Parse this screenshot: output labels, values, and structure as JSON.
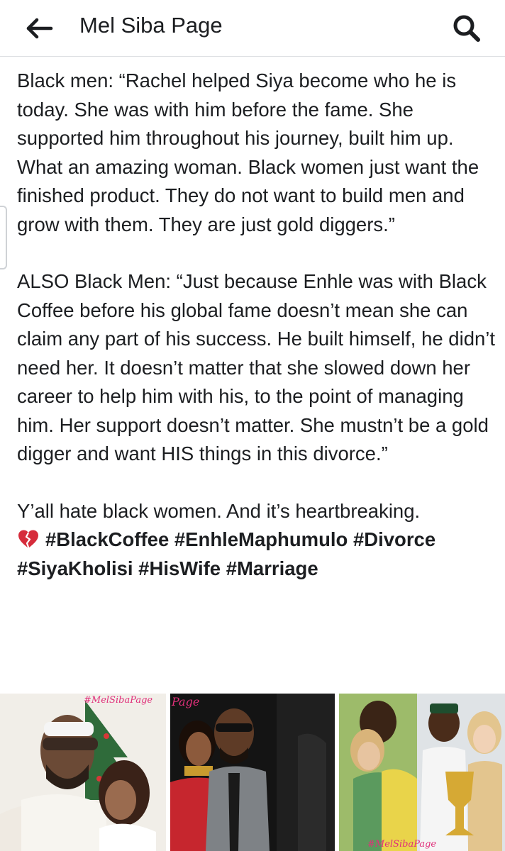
{
  "header": {
    "title": "Mel Siba Page",
    "back_icon": "arrow-left-icon",
    "search_icon": "search-icon"
  },
  "post": {
    "paragraph_1": "Black men: “Rachel helped Siya become who he is today. She was with him before the fame. She supported him throughout his journey, built him up. What an amazing woman. Black women just want the finished product. They do not want to build men and grow with them. They are just gold diggers.”",
    "paragraph_2": "ALSO Black Men: “Just because Enhle was with Black Coffee before his global fame doesn’t mean she can claim any part of his success. He built himself, he didn’t need her. It doesn’t matter that she slowed down her career to help him with his, to the point of managing him. Her support doesn’t matter. She mustn’t be a gold digger and want HIS things in this divorce.”",
    "closing_line": "Y’all hate black women. And it’s heartbreaking.",
    "hashtags_line_1": "#BlackCoffee #EnhleMaphumulo #Divorce",
    "hashtags_line_2": "#SiyaKholisi #HisWife #Marriage",
    "emoji": "broken-heart-icon"
  },
  "photos": {
    "photo_1_watermark": "#MelSibaPage",
    "photo_2_watermark": "Page",
    "photo_3_watermark": "#MelSibaPage"
  },
  "colors": {
    "text": "#1c1e21",
    "divider": "#dddfe2",
    "watermark": "#e0307a",
    "broken_heart": "#d62c3b"
  }
}
